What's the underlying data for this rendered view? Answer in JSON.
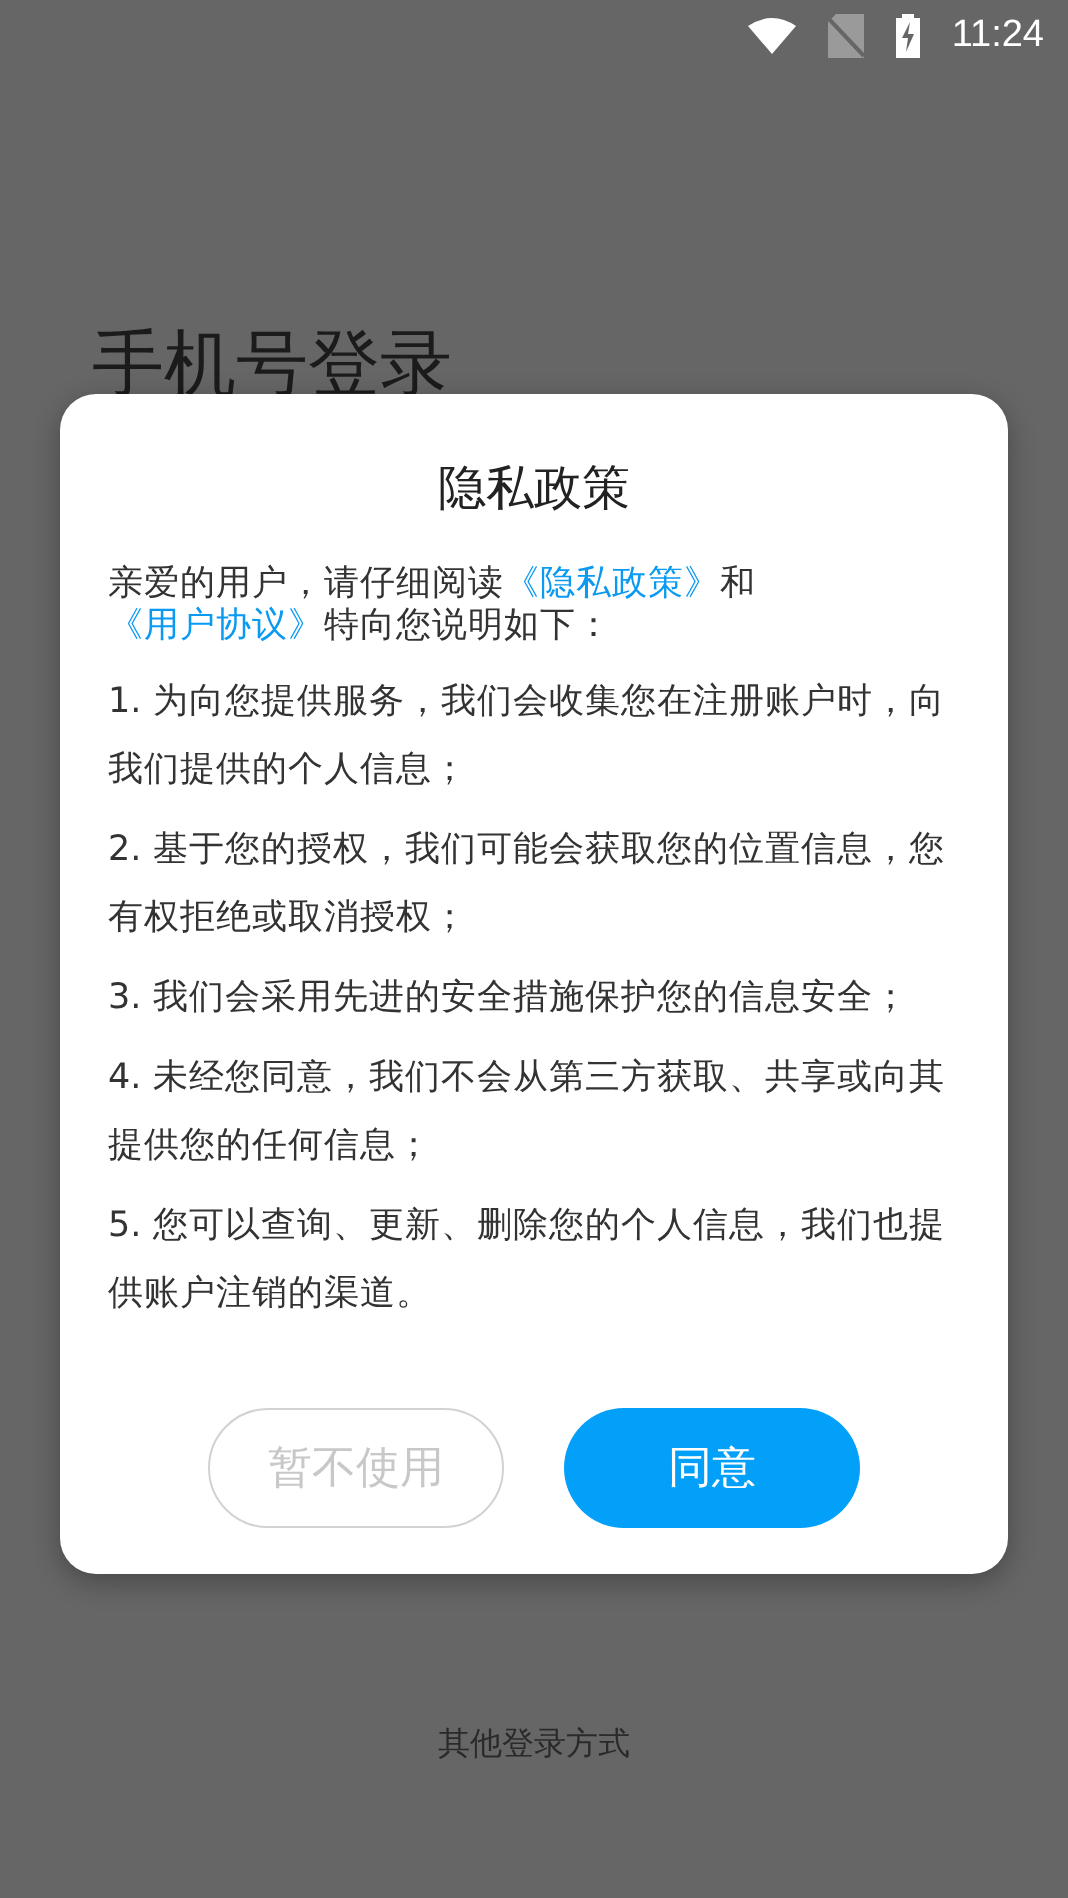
{
  "status_bar": {
    "time": "11:24"
  },
  "page": {
    "title": "手机号登录",
    "footer_link": "其他登录方式"
  },
  "dialog": {
    "title": "隐私政策",
    "intro": [
      {
        "kind": "text",
        "text": "亲爱的用户，请仔细阅读"
      },
      {
        "kind": "link",
        "text": "《隐私政策》"
      },
      {
        "kind": "text",
        "text": "和"
      },
      {
        "kind": "link",
        "text": "《用户协议》"
      },
      {
        "kind": "text",
        "text": "特向您说明如下："
      }
    ],
    "items": [
      "1. 为向您提供服务，我们会收集您在注册账户时，向我们提供的个人信息；",
      "2. 基于您的授权，我们可能会获取您的位置信息，您有权拒绝或取消授权；",
      "3. 我们会采用先进的安全措施保护您的信息安全；",
      "4. 未经您同意，我们不会从第三方获取、共享或向其提供您的任何信息；",
      "5. 您可以查询、更新、删除您的个人信息，我们也提供账户注销的渠道。"
    ],
    "buttons": [
      {
        "label": "暂不使用",
        "kind": "secondary"
      },
      {
        "label": "同意",
        "kind": "primary"
      }
    ]
  }
}
